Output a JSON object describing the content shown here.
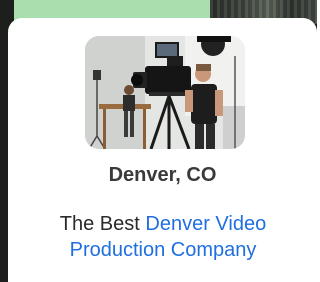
{
  "location_card": {
    "city": "Denver, CO",
    "description_prefix": "The Best ",
    "link_text": "Denver Video Production Company",
    "link_color": "#1f6fe0"
  },
  "photo": {
    "subject": "video production crew operating camera in studio"
  }
}
